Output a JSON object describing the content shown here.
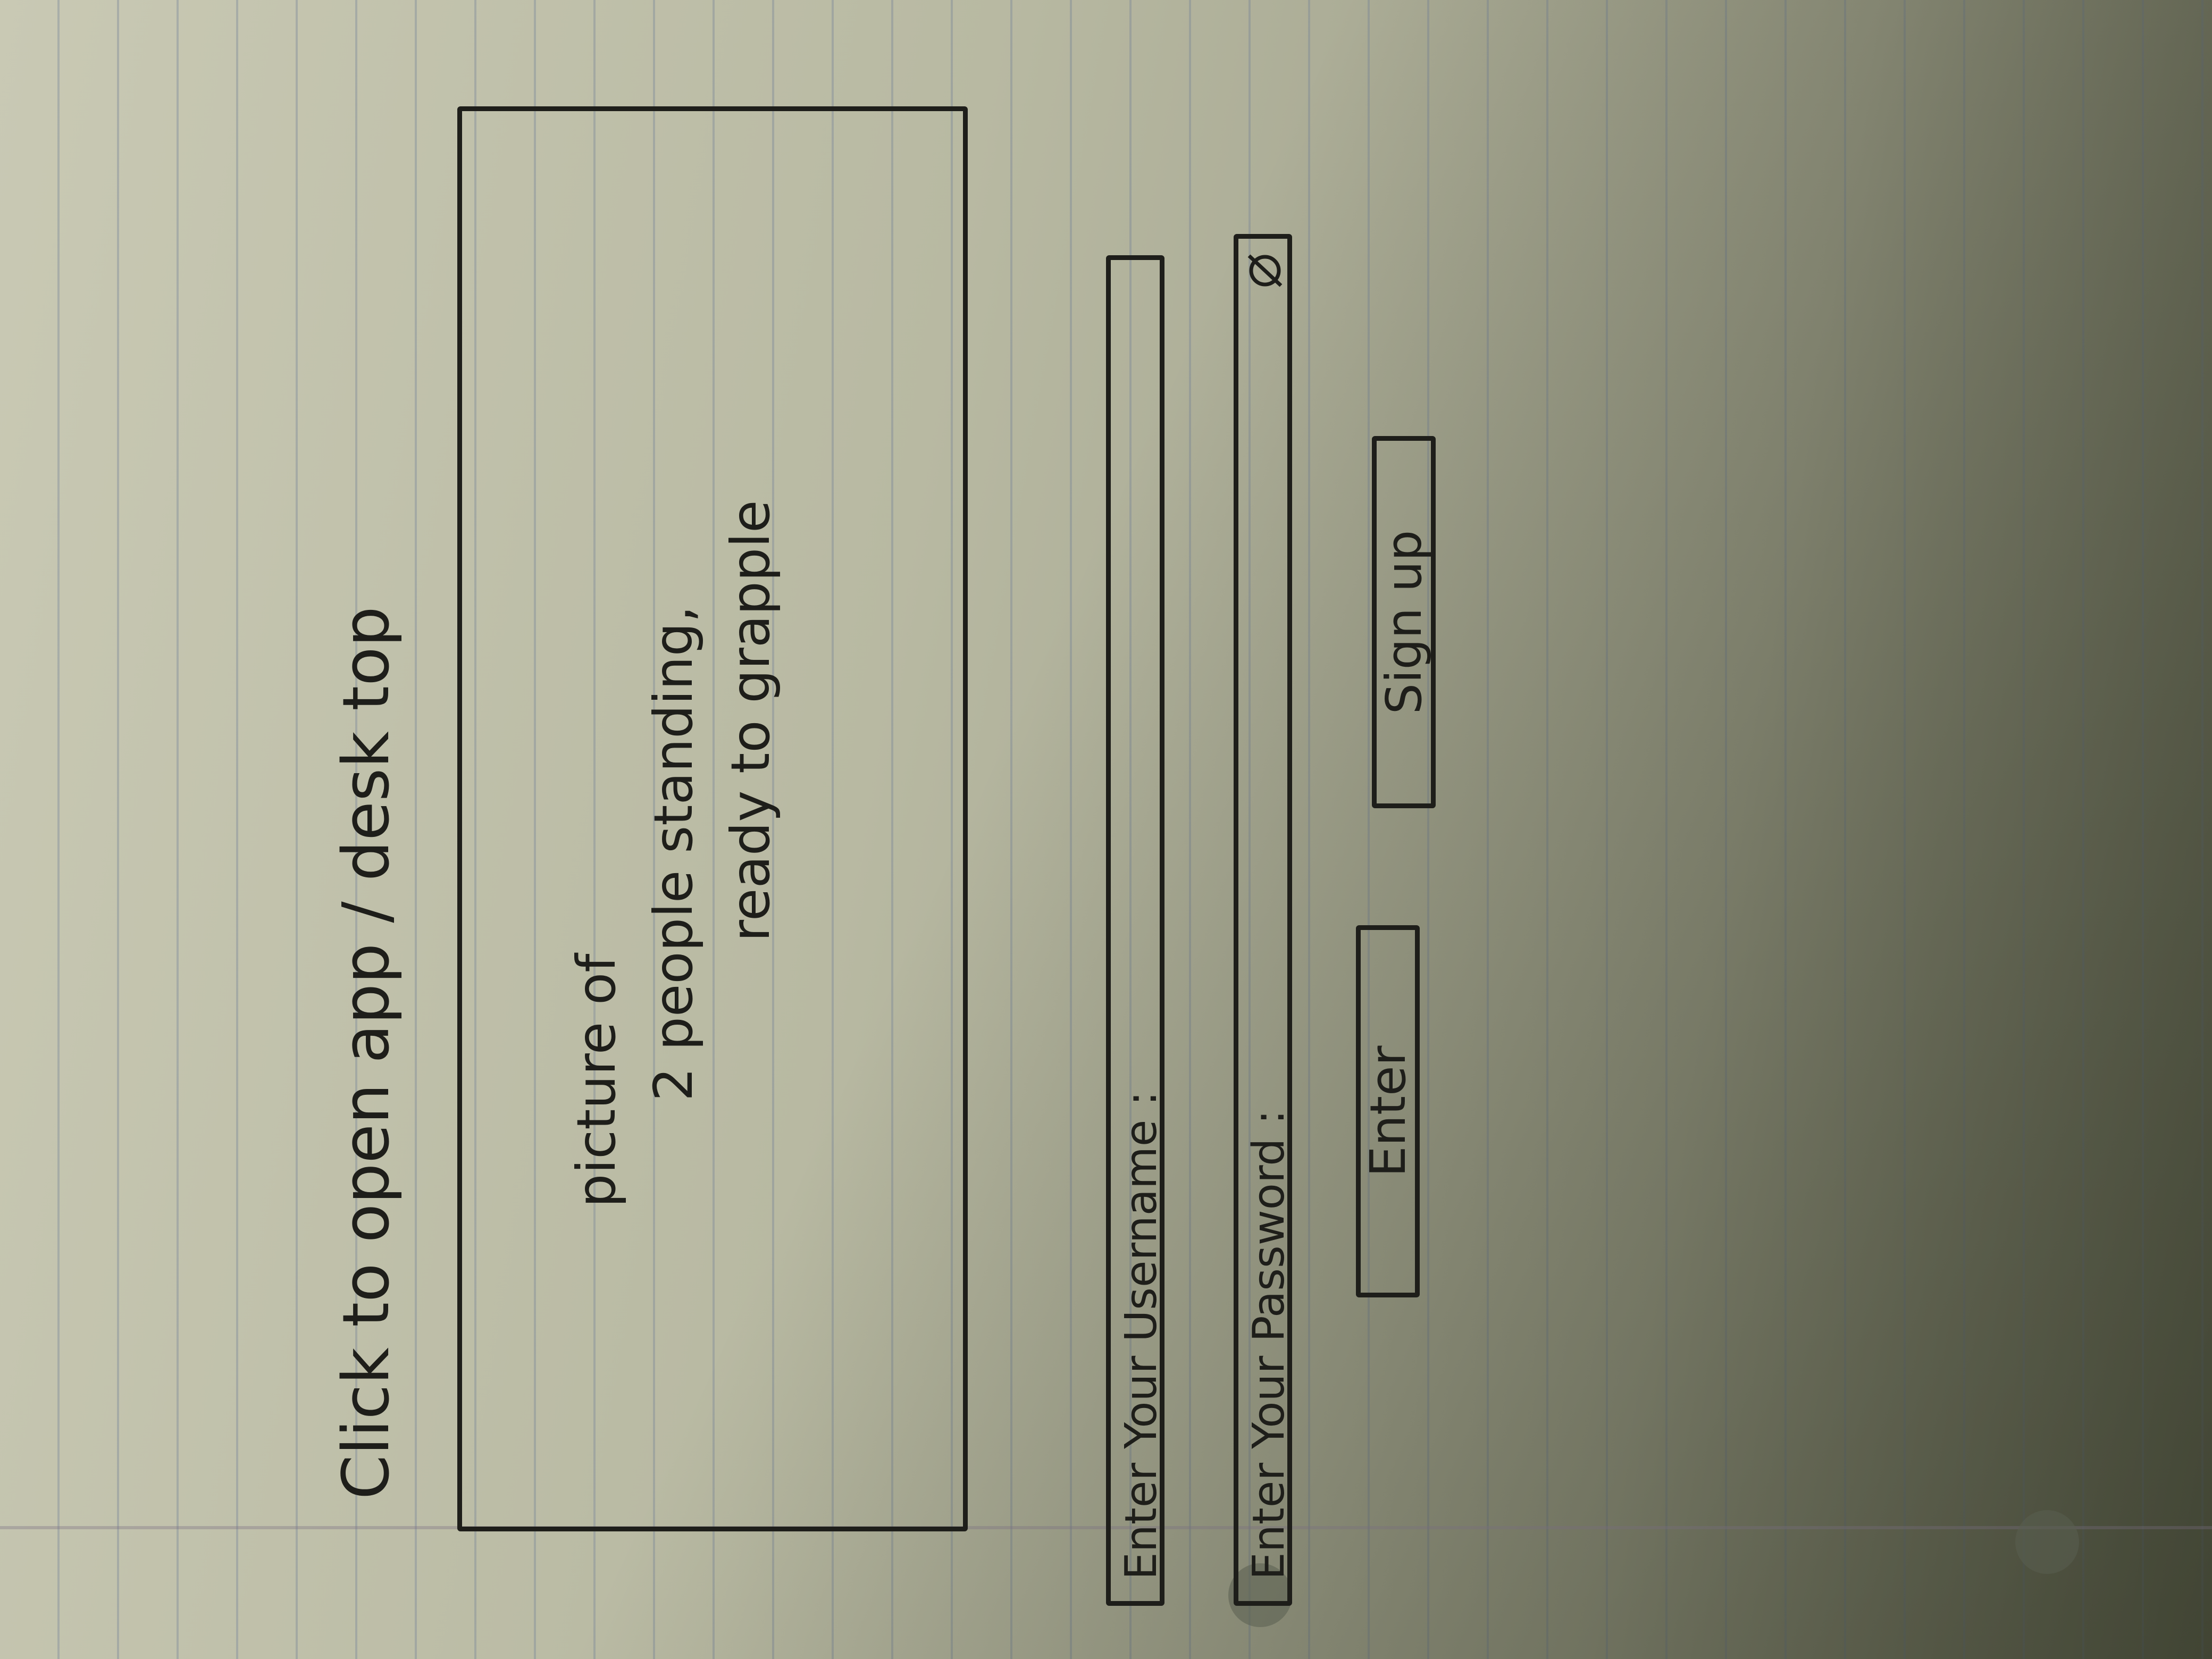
{
  "note": {
    "text": "Click to open app / desk top"
  },
  "hero": {
    "lines": [
      "picture of",
      "2 people standing,",
      "ready to grapple"
    ]
  },
  "login": {
    "username_label": "Enter Your Username :",
    "password_label": "Enter Your Password :",
    "password_toggle_icon": "eye-slash-icon"
  },
  "buttons": {
    "enter_label": "Enter",
    "signup_label": "Sign up"
  }
}
